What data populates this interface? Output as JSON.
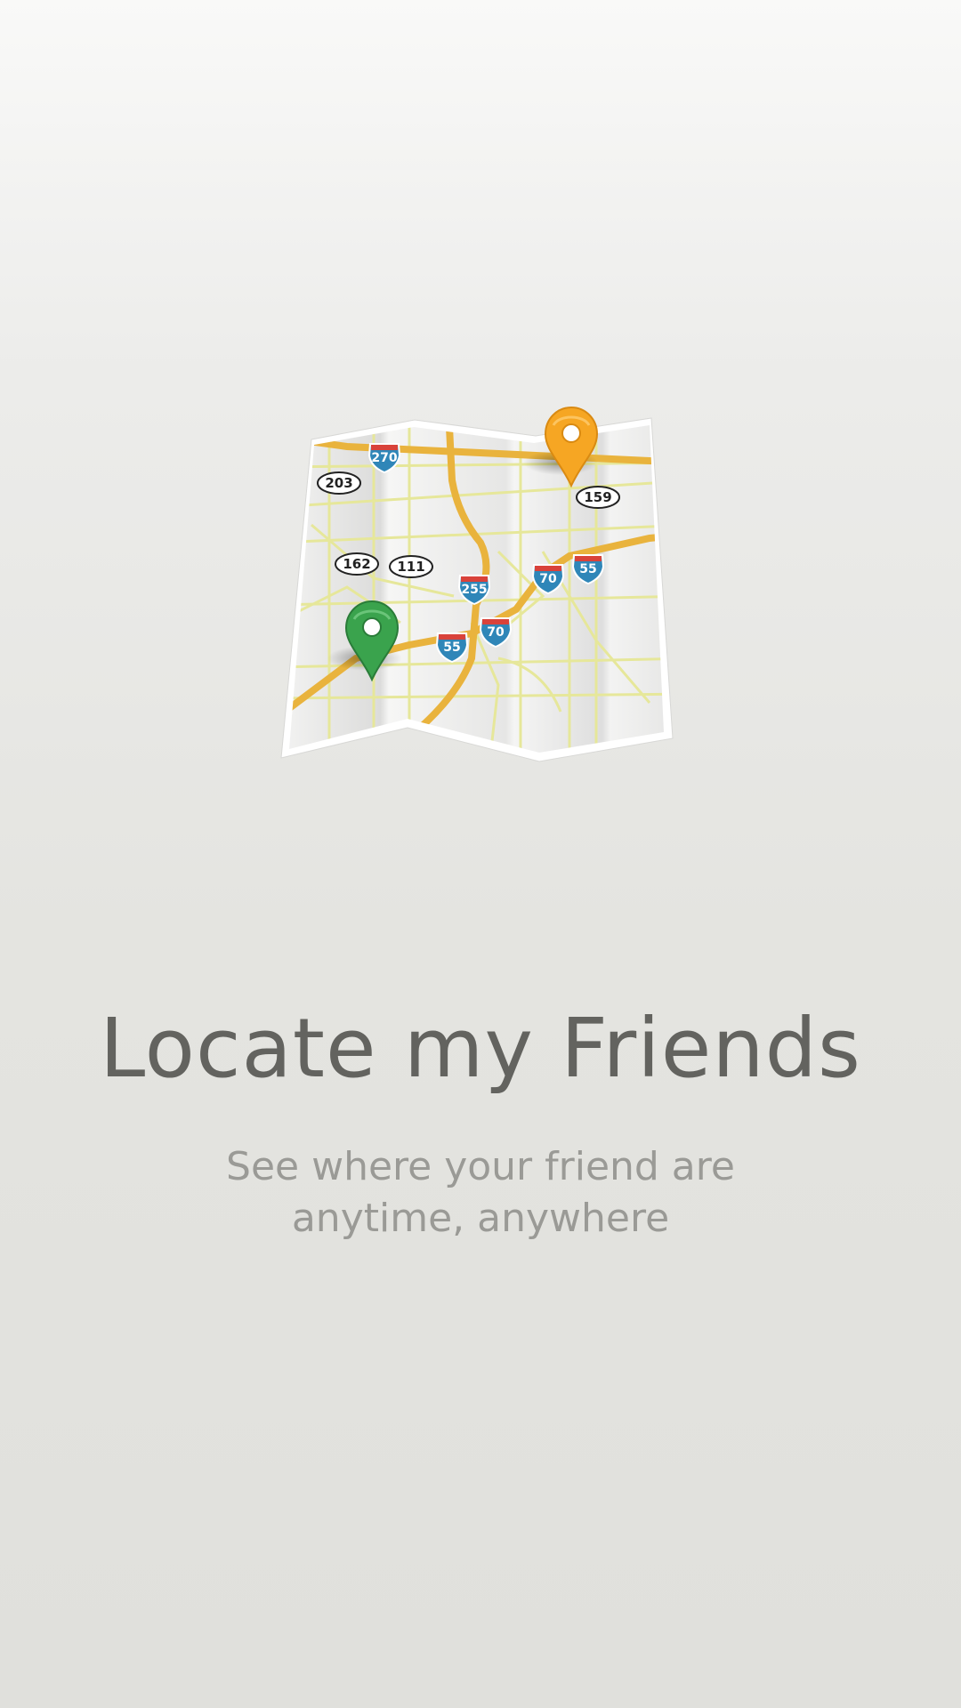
{
  "onboarding": {
    "title": "Locate my Friends",
    "subtitle_line1": "See where your friend are",
    "subtitle_line2": "anytime, anywhere"
  },
  "map": {
    "route_shields": [
      "270",
      "255",
      "70",
      "55",
      "70",
      "55"
    ],
    "state_route_labels": [
      "203",
      "162",
      "111",
      "159"
    ],
    "pins": [
      {
        "name": "orange-pin",
        "color": "#f6a623"
      },
      {
        "name": "green-pin",
        "color": "#3aa34d"
      }
    ]
  },
  "colors": {
    "title": "#63635f",
    "subtitle": "#9a9a96",
    "highway": "#e9b33d",
    "minor_road": "#e6e79a",
    "interstate_blue": "#2f86b8",
    "interstate_red": "#d9423a"
  }
}
